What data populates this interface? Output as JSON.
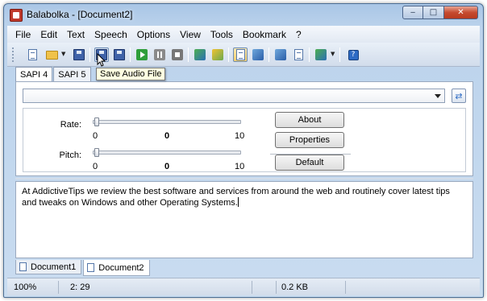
{
  "window": {
    "title": "Balabolka - [Document2]",
    "minimize_glyph": "‒",
    "maximize_glyph": "□",
    "close_glyph": "✕"
  },
  "menu": [
    "File",
    "Edit",
    "Text",
    "Speech",
    "Options",
    "View",
    "Tools",
    "Bookmark",
    "?"
  ],
  "toolbar": {
    "tooltip": "Save Audio File",
    "help_glyph": "?"
  },
  "engine_tabs": [
    "SAPI 4",
    "SAPI 5"
  ],
  "voice": {
    "selected": "",
    "refresh_glyph": "⇄"
  },
  "settings": {
    "rate_label": "Rate:",
    "pitch_label": "Pitch:",
    "rate": {
      "min": "0",
      "mid": "0",
      "max": "10",
      "value": 0
    },
    "pitch": {
      "min": "0",
      "mid": "0",
      "max": "10",
      "value": 0
    },
    "about_label": "About",
    "properties_label": "Properties",
    "default_label": "Default"
  },
  "editor": {
    "text": "At AddictiveTips we review the best software and services from around the web and routinely cover latest tips and tweaks on Windows and other Operating Systems."
  },
  "documents": [
    "Document1",
    "Document2"
  ],
  "status": {
    "zoom": "100%",
    "position": "2:  29",
    "size": "0.2 KB"
  },
  "colors": {
    "accent": "#2e6bc4",
    "close_button": "#c64b30",
    "tooltip_bg": "#ffffe1"
  }
}
